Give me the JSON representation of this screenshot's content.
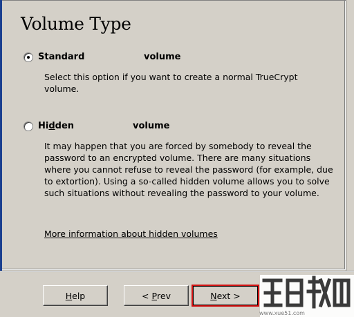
{
  "header": {
    "title": "Volume Type"
  },
  "options": {
    "standard": {
      "label_part1": "Standard",
      "label_part2": "volume",
      "description": "Select this option if you want to create a normal TrueCrypt volume.",
      "checked": true
    },
    "hidden": {
      "label_pre": "Hi",
      "label_accel": "d",
      "label_post": "den",
      "label_part2": "volume",
      "description": "It may happen that you are forced by somebody to reveal the password to an encrypted volume. There are many situations where you cannot refuse to reveal the password (for example, due to extortion). Using a so-called hidden volume allows you to solve such situations without revealing the password to your volume.",
      "checked": false
    }
  },
  "link": {
    "text": "More information about hidden volumes"
  },
  "buttons": {
    "help": {
      "accel": "H",
      "rest": "elp"
    },
    "prev": {
      "pre": "< ",
      "accel": "P",
      "rest": "rev"
    },
    "next": {
      "accel": "N",
      "rest": "ext >"
    }
  },
  "watermark": {
    "site": "www.xue51.com"
  }
}
